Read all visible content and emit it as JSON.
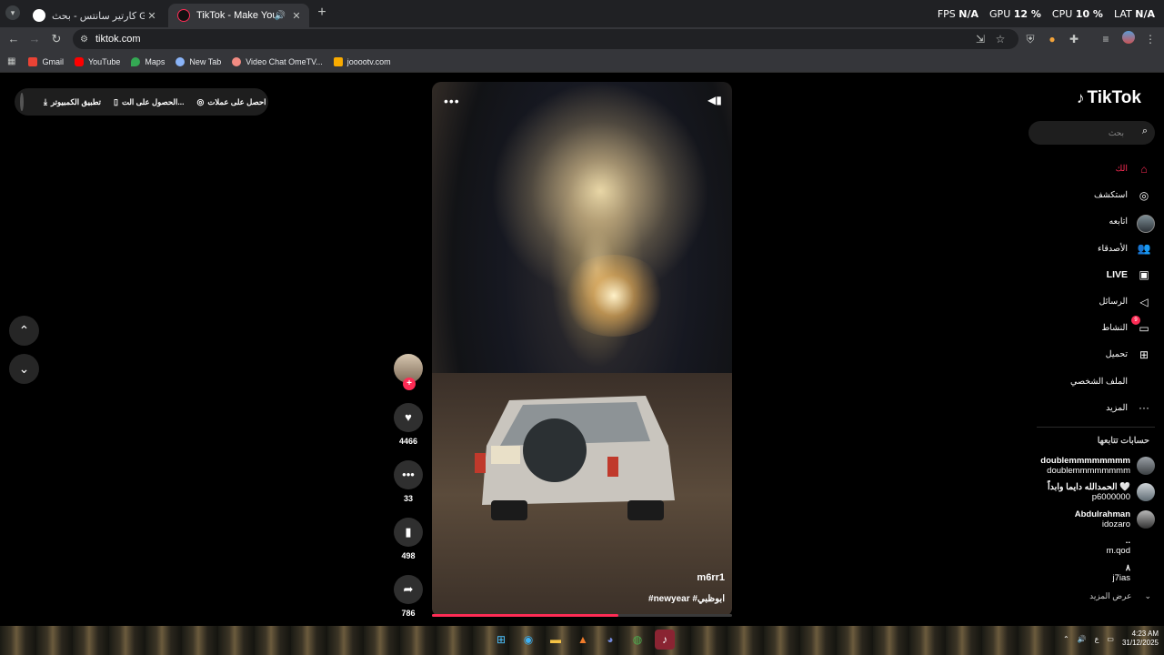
{
  "browser": {
    "tabs": [
      {
        "title": "كارتير سانتس - بحث Google",
        "active": false
      },
      {
        "title": "TikTok - Make Your Day",
        "active": true
      }
    ],
    "url": "tiktok.com",
    "bookmarks": [
      "Gmail",
      "YouTube",
      "Maps",
      "New Tab",
      "Video Chat OmeTV...",
      "jooootv.com"
    ],
    "perf": {
      "fps_label": "FPS",
      "fps_value": "N/A",
      "gpu_label": "GPU",
      "gpu_value": "12 %",
      "cpu_label": "CPU",
      "cpu_value": "10 %",
      "lat_label": "LAT",
      "lat_value": "N/A"
    }
  },
  "topbar": {
    "get_coins": "احصل على عملات",
    "get_app": "الحصول على الت...",
    "desktop_app": "تطبيق الكمبيوتر"
  },
  "sidebar": {
    "logo": "TikTok",
    "search_placeholder": "بحث",
    "nav": [
      {
        "label": "الك",
        "icon": "home-icon"
      },
      {
        "label": "استكشف",
        "icon": "compass-icon"
      },
      {
        "label": "اتابعه",
        "icon": "avatar"
      },
      {
        "label": "الأصدقاء",
        "icon": "friends-icon"
      },
      {
        "label": "LIVE",
        "icon": "live-icon"
      },
      {
        "label": "الرسائل",
        "icon": "send-icon"
      },
      {
        "label": "النشاط",
        "icon": "activity-icon",
        "badge": "9"
      },
      {
        "label": "تحميل",
        "icon": "upload-icon"
      },
      {
        "label": "الملف الشخصي",
        "icon": "profile-icon"
      },
      {
        "label": "المزيد",
        "icon": "more-icon"
      }
    ],
    "following_title": "حسابات تتابعها",
    "following": [
      {
        "name": "doublemmmmmmmm",
        "handle": "doublemmmmmmmm"
      },
      {
        "name": "الحمدالله دايما وابداً 🤍",
        "handle": "p6000000"
      },
      {
        "name": "Abdulrahman",
        "handle": "idozaro"
      },
      {
        "name": "..",
        "handle": "m.qod"
      },
      {
        "name": "٨",
        "handle": "j7ias"
      }
    ],
    "see_more": "عرض المزيد"
  },
  "video": {
    "author": "m6rr1",
    "caption": "#newyear #ابوظبي",
    "progress": 0.62,
    "likes": "4466",
    "comments": "33",
    "saves": "498",
    "shares": "786"
  },
  "taskbar": {
    "time": "4:23 AM",
    "date": "31/12/2025",
    "lang": "ع"
  },
  "colors": {
    "accent": "#fe2c55",
    "background": "#000000",
    "chrome_dark": "#202124",
    "chrome_bar": "#35363a"
  }
}
